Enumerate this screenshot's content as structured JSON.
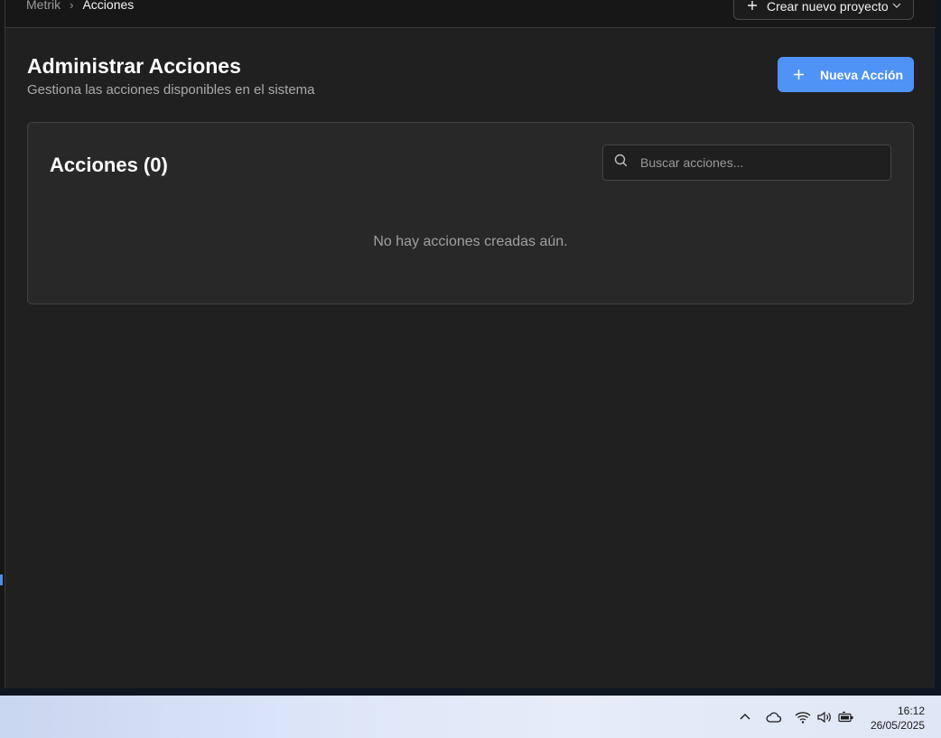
{
  "breadcrumb": {
    "root": "Metrik",
    "separator": "›",
    "current": "Acciones"
  },
  "header": {
    "project_button_label": "Crear nuevo proyecto"
  },
  "page": {
    "title": "Administrar Acciones",
    "subtitle": "Gestiona las acciones disponibles en el sistema",
    "new_button_label": "Nueva Acción"
  },
  "card": {
    "title": "Acciones (0)",
    "search_placeholder": "Buscar acciones...",
    "empty_message": "No hay acciones creadas aún."
  },
  "taskbar": {
    "time": "16:12",
    "date": "26/05/2025",
    "tray_icons": [
      "chevron-up-icon",
      "cloud-icon",
      "wifi-icon",
      "volume-icon",
      "battery-icon"
    ]
  },
  "colors": {
    "accent": "#4f93f7",
    "background": "#202020",
    "card": "#282828"
  }
}
